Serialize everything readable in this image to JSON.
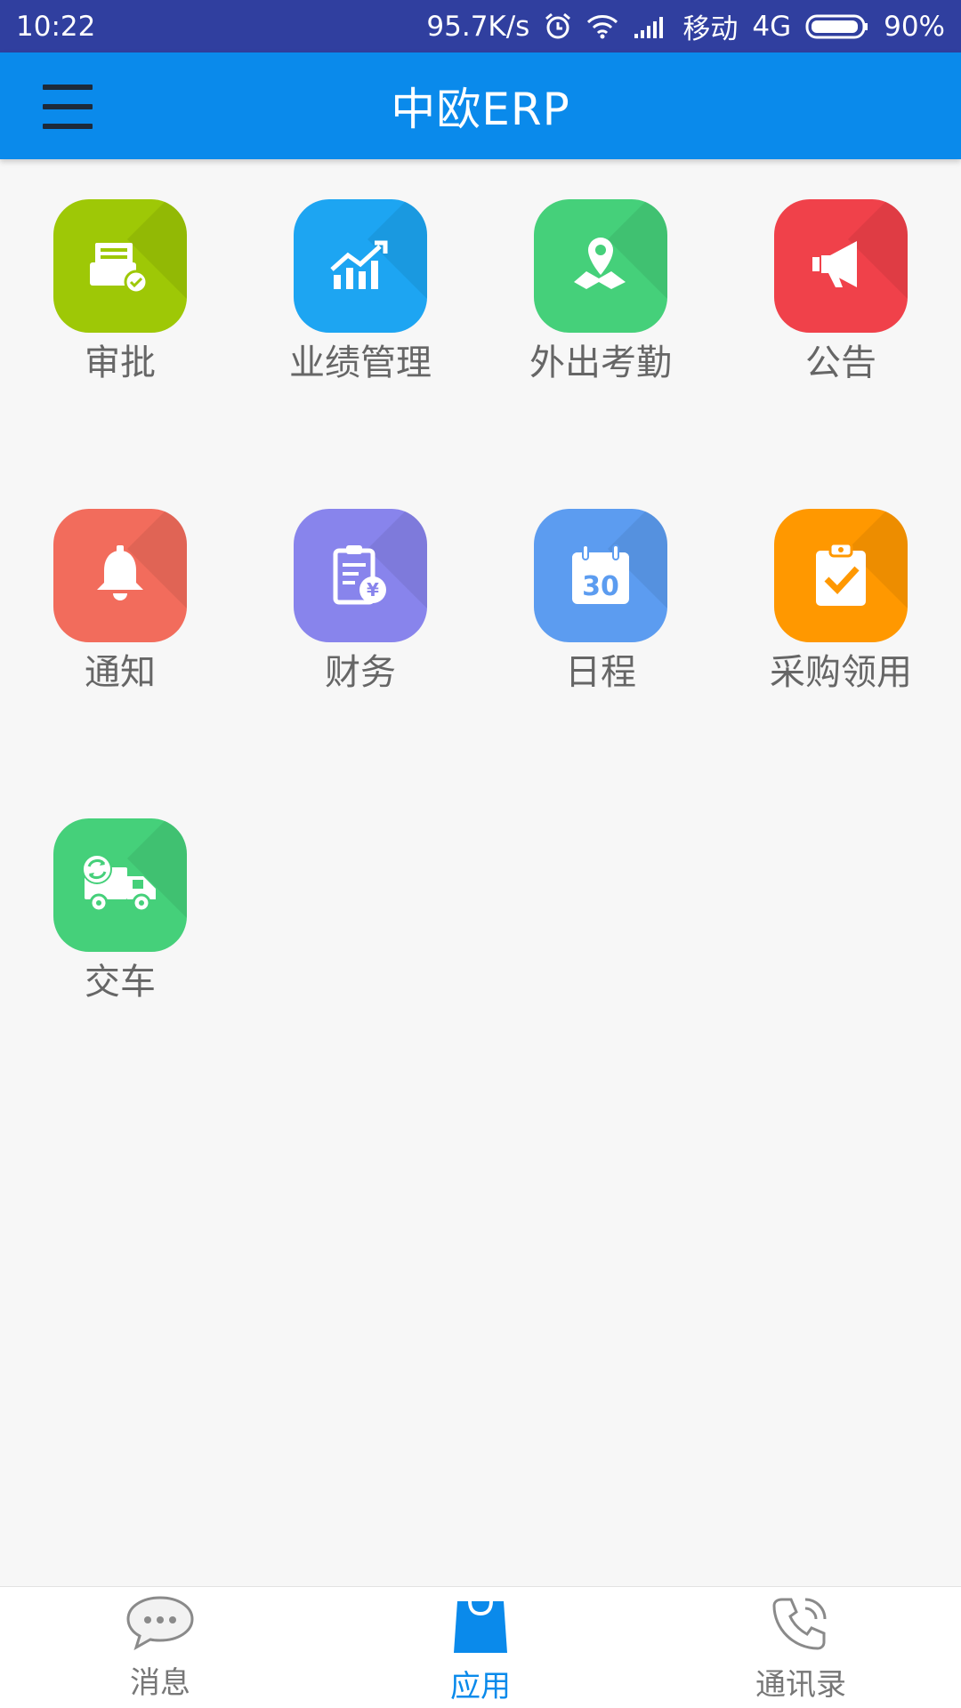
{
  "status_bar": {
    "time": "10:22",
    "net_speed": "95.7K/s",
    "carrier": "移动",
    "network": "4G",
    "battery": "90%"
  },
  "app_bar": {
    "title": "中欧ERP"
  },
  "apps": [
    {
      "label": "审批",
      "color": "#9ec806",
      "icon": "approval-icon"
    },
    {
      "label": "业绩管理",
      "color": "#1da5f2",
      "icon": "performance-chart-icon"
    },
    {
      "label": "外出考勤",
      "color": "#45d07a",
      "icon": "location-map-icon"
    },
    {
      "label": "公告",
      "color": "#f0414a",
      "icon": "megaphone-icon"
    },
    {
      "label": "通知",
      "color": "#f26c5c",
      "icon": "bell-icon"
    },
    {
      "label": "财务",
      "color": "#8884ec",
      "icon": "finance-clipboard-icon"
    },
    {
      "label": "日程",
      "color": "#5c9cf0",
      "icon": "calendar-icon"
    },
    {
      "label": "采购领用",
      "color": "#ff9800",
      "icon": "clipboard-check-icon"
    },
    {
      "label": "交车",
      "color": "#45d07a",
      "icon": "delivery-truck-icon"
    }
  ],
  "calendar_day": "30",
  "bottom_nav": [
    {
      "label": "消息",
      "icon": "chat-bubble-icon",
      "active": false
    },
    {
      "label": "应用",
      "icon": "shopping-bag-icon",
      "active": true
    },
    {
      "label": "通讯录",
      "icon": "phone-icon",
      "active": false
    }
  ],
  "colors": {
    "status_bar": "#303f9f",
    "app_bar": "#0a8aeb",
    "active_tab": "#0a8aeb"
  }
}
